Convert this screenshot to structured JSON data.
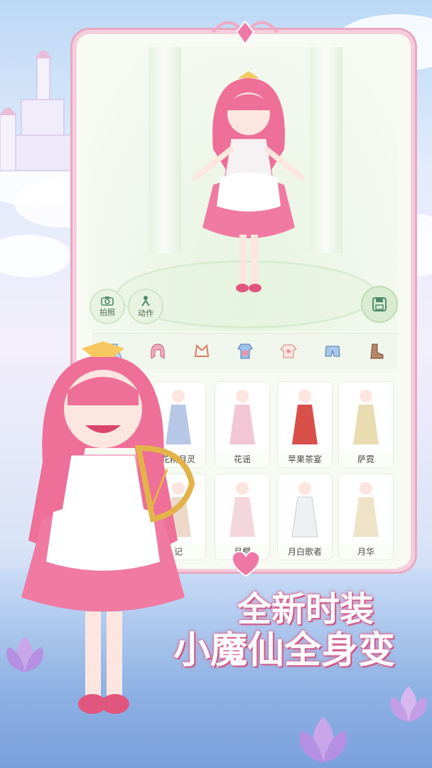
{
  "colors": {
    "accent_pink": "#e86a9a",
    "frame_pink": "#f6cddd",
    "panel_green": "#e8f3e2",
    "text_dark": "#4a4a4a"
  },
  "controls": {
    "photo_label": "拍照",
    "action_label": "动作",
    "photo_icon": "camera-icon",
    "action_icon": "pose-icon",
    "save_icon": "save-icon"
  },
  "tabs": [
    {
      "icon": "dress-icon"
    },
    {
      "icon": "hair-icon"
    },
    {
      "icon": "cat-ears-icon"
    },
    {
      "icon": "top-icon"
    },
    {
      "icon": "shirt-icon"
    },
    {
      "icon": "shorts-icon"
    },
    {
      "icon": "boots-icon"
    }
  ],
  "outfits": [
    {
      "name": "花精月灵",
      "color": "#b7c7e6"
    },
    {
      "name": "花谣",
      "color": "#f3c6d6"
    },
    {
      "name": "苹果茶宴",
      "color": "#d9504a"
    },
    {
      "name": "萨霓",
      "color": "#e8dcb0"
    },
    {
      "name": "记",
      "color": "#ecd9c9"
    },
    {
      "name": "月樱",
      "color": "#f4d7dc"
    },
    {
      "name": "月白歌者",
      "color": "#eef0f2"
    },
    {
      "name": "月华",
      "color": "#efe3c8"
    }
  ],
  "headline": {
    "line1": "全新时装",
    "line2": "小魔仙全身变"
  }
}
